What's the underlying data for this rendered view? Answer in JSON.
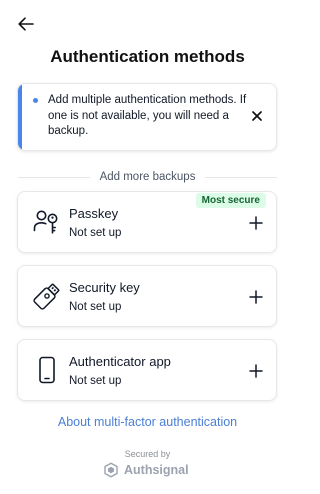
{
  "header": {
    "title": "Authentication methods",
    "back_icon": "arrow-left-icon"
  },
  "alert": {
    "message": "Add multiple authentication methods. If one is not available, you will need a backup.",
    "accent_color": "#4a86e8",
    "close_icon": "close-icon"
  },
  "divider": {
    "label": "Add more backups"
  },
  "methods": [
    {
      "name": "Passkey",
      "status": "Not set up",
      "icon": "passkey-icon",
      "badge": "Most secure",
      "badge_color": "#dcfce7"
    },
    {
      "name": "Security key",
      "status": "Not set up",
      "icon": "security-key-icon"
    },
    {
      "name": "Authenticator app",
      "status": "Not set up",
      "icon": "smartphone-icon"
    }
  ],
  "footer": {
    "link": "About multi-factor authentication",
    "link_color": "#4a7fd6",
    "secured_by": "Secured by",
    "brand": "Authsignal"
  }
}
